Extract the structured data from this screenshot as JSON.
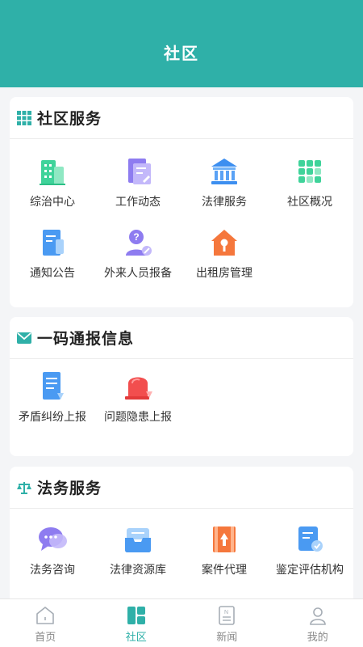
{
  "header": {
    "title": "社区"
  },
  "sections": [
    {
      "title": "社区服务",
      "items": [
        {
          "label": "综治中心",
          "icon": "building-icon"
        },
        {
          "label": "工作动态",
          "icon": "document-edit-icon"
        },
        {
          "label": "法律服务",
          "icon": "courthouse-icon"
        },
        {
          "label": "社区概况",
          "icon": "grid-apps-icon"
        },
        {
          "label": "通知公告",
          "icon": "notice-doc-icon"
        },
        {
          "label": "外来人员报备",
          "icon": "visitor-question-icon"
        },
        {
          "label": "出租房管理",
          "icon": "house-key-icon"
        }
      ]
    },
    {
      "title": "一码通报信息",
      "items": [
        {
          "label": "矛盾纠纷上报",
          "icon": "report-doc-icon"
        },
        {
          "label": "问题隐患上报",
          "icon": "alarm-light-icon"
        }
      ]
    },
    {
      "title": "法务服务",
      "items": [
        {
          "label": "法务咨询",
          "icon": "chat-bubble-icon"
        },
        {
          "label": "法律资源库",
          "icon": "inbox-tray-icon"
        },
        {
          "label": "案件代理",
          "icon": "case-folder-icon"
        },
        {
          "label": "鉴定评估机构",
          "icon": "appraisal-doc-icon"
        }
      ]
    }
  ],
  "tabbar": [
    {
      "label": "首页",
      "icon": "home-icon",
      "active": false
    },
    {
      "label": "社区",
      "icon": "community-icon",
      "active": true
    },
    {
      "label": "新闻",
      "icon": "news-icon",
      "active": false
    },
    {
      "label": "我的",
      "icon": "user-icon",
      "active": false
    }
  ],
  "colors": {
    "primary": "#2fb0a8",
    "tab_inactive": "#888888"
  }
}
